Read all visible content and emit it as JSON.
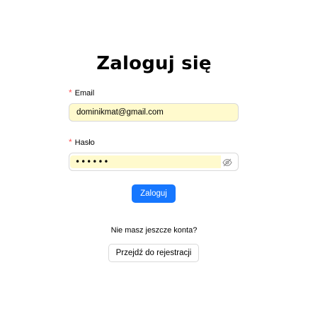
{
  "page": {
    "title": "Zaloguj się"
  },
  "form": {
    "required_mark": "*",
    "email": {
      "label": "Email",
      "value": "dominikmat@gmail.com"
    },
    "password": {
      "label": "Hasło",
      "value": "••••••",
      "toggle_icon": "eye-invisible-icon"
    },
    "submit_label": "Zaloguj"
  },
  "register": {
    "prompt": "Nie masz jeszcze konta?",
    "button_label": "Przejdź do rejestracji"
  },
  "colors": {
    "primary": "#1677ff",
    "required": "#ff4d4f",
    "autofill": "#fffacd",
    "border": "#d9d9d9"
  }
}
